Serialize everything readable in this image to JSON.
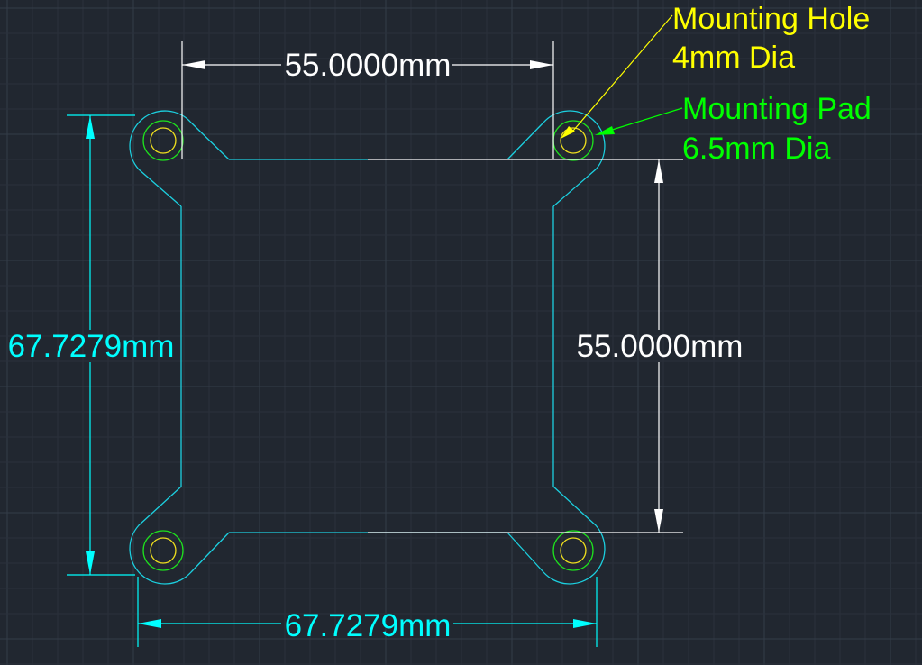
{
  "colors": {
    "background": "#212730",
    "grid_minor": "#2a313b",
    "grid_major": "#343c48",
    "outline": "#1ccfdf",
    "dimension_cyan": "#00ffff",
    "dimension_white": "#ffffff",
    "pad": "#1ee01e",
    "hole": "#f0e01e",
    "label_yellow": "#ffff00",
    "label_green": "#00ff00"
  },
  "dimensions": {
    "top_horizontal": "55.0000mm",
    "right_vertical": "55.0000mm",
    "left_vertical": "67.7279mm",
    "bottom_horizontal": "67.7279mm"
  },
  "callouts": {
    "hole": {
      "line1": "Mounting Hole",
      "line2": "4mm Dia"
    },
    "pad": {
      "line1": "Mounting Pad",
      "line2": "6.5mm Dia"
    }
  }
}
